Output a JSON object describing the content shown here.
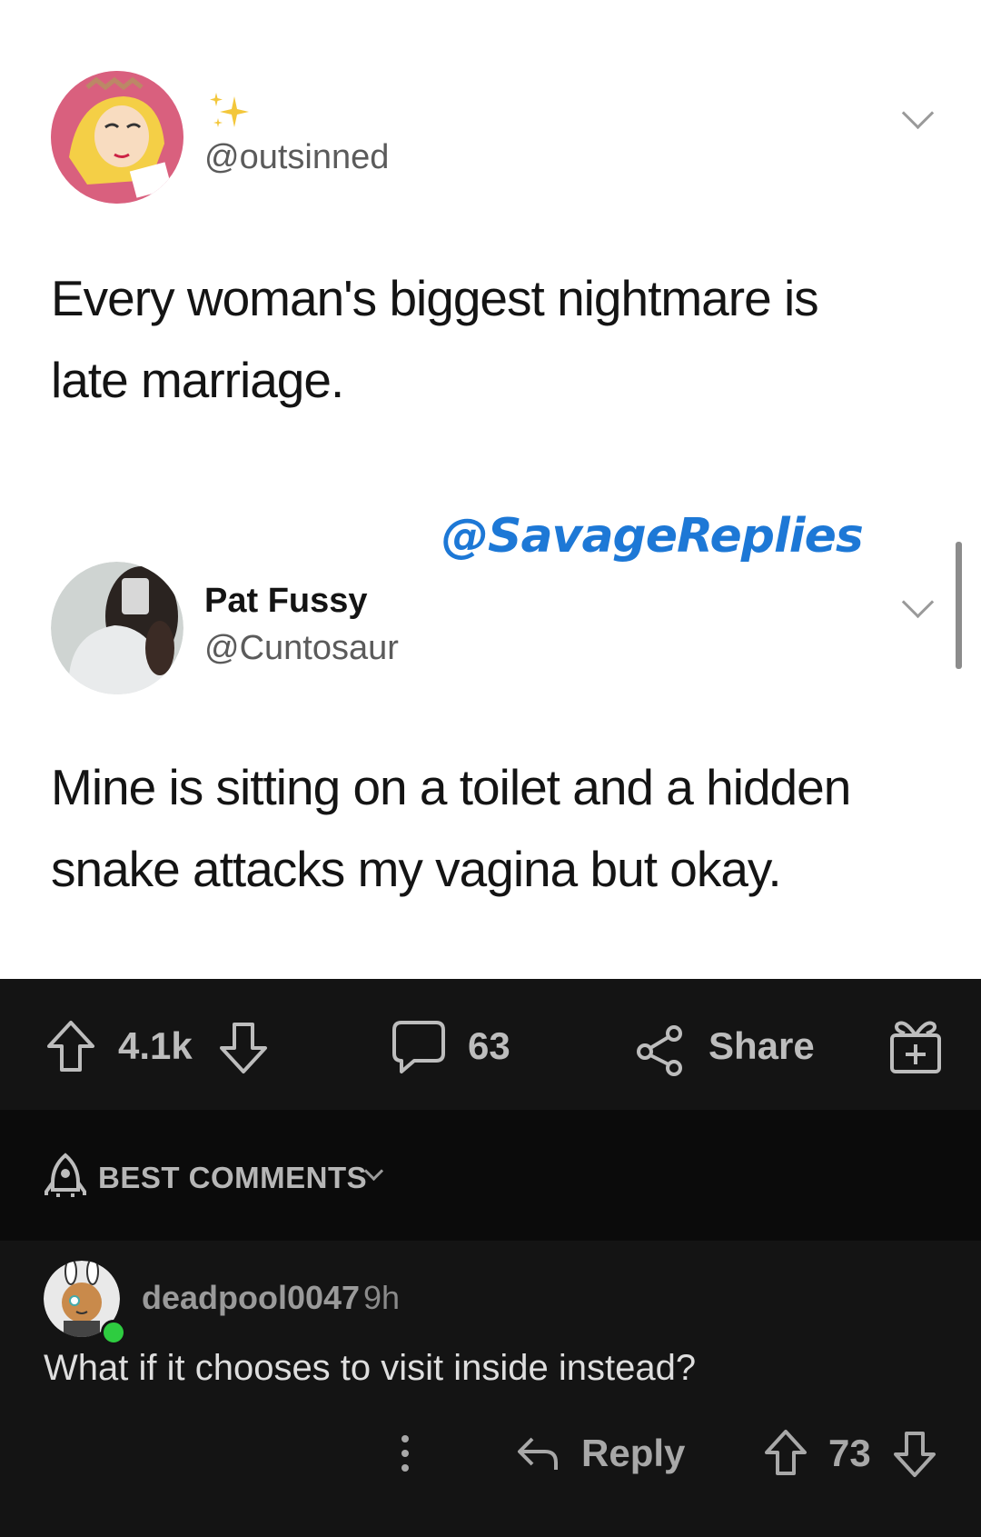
{
  "tweet1": {
    "handle": "@outsinned",
    "text_line1": "Every woman's biggest nightmare is",
    "text_line2": "late marriage."
  },
  "watermark": "@SavageReplies",
  "tweet2": {
    "name": "Pat Fussy",
    "handle": "@Cuntosaur",
    "text_line1": "Mine is sitting on a toilet and a hidden",
    "text_line2": "snake attacks my vagina but okay."
  },
  "post_bar": {
    "score": "4.1k",
    "comments": "63",
    "share_label": "Share"
  },
  "sort": {
    "label": "BEST COMMENTS"
  },
  "comment": {
    "username": "deadpool0047",
    "time": "9h",
    "text": "What if it chooses to visit inside instead?",
    "reply_label": "Reply",
    "score": "73"
  },
  "colors": {
    "dark_bg": "#141414",
    "sort_bg": "#0b0b0b",
    "watermark": "#1d78d6",
    "online": "#2ecc40"
  }
}
